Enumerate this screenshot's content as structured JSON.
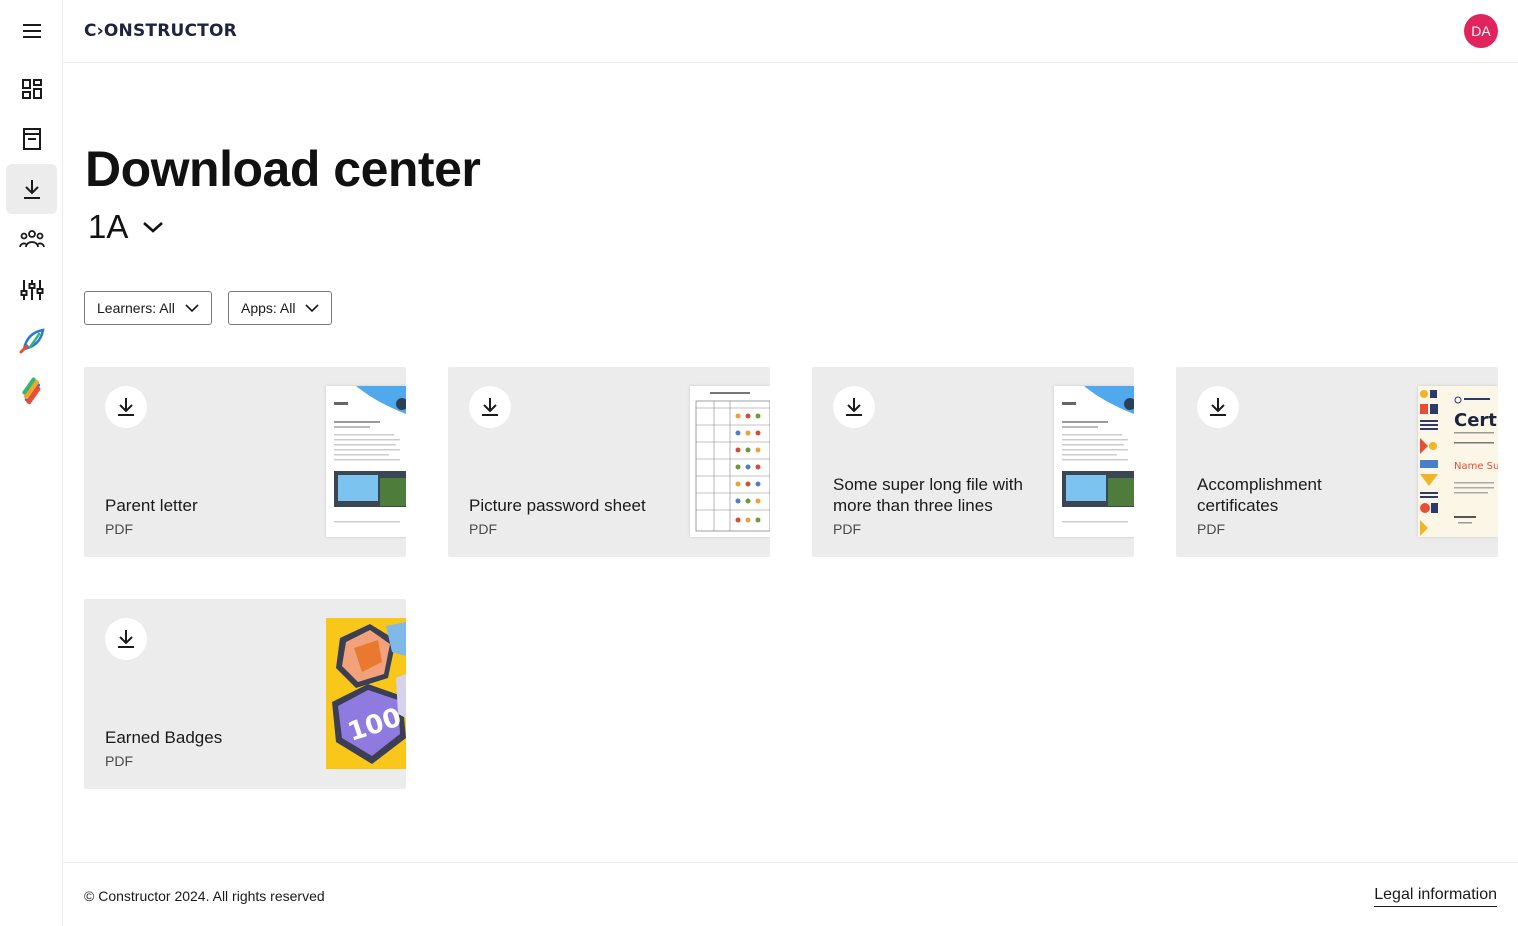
{
  "app": {
    "brand": "C›ONSTRUCTOR",
    "avatar_initials": "DA",
    "avatar_color": "#e0245e"
  },
  "sidebar": {
    "items": [
      {
        "icon": "menu-icon"
      },
      {
        "icon": "dashboard-icon"
      },
      {
        "icon": "book-icon"
      },
      {
        "icon": "download-icon",
        "active": true
      },
      {
        "icon": "people-icon"
      },
      {
        "icon": "sliders-icon"
      },
      {
        "icon": "rocket-app-icon"
      },
      {
        "icon": "colorful-app-icon"
      }
    ]
  },
  "main": {
    "title": "Download center",
    "class_selector": {
      "value": "1A"
    },
    "filters": {
      "learners": "Learners: All",
      "apps": "Apps: All"
    },
    "cards": [
      {
        "name": "Parent letter",
        "type": "PDF",
        "thumb": "letter-thumbnail"
      },
      {
        "name": "Picture password sheet",
        "type": "PDF",
        "thumb": "password-sheet-thumbnail"
      },
      {
        "name": "Some super long file with more than three lines",
        "type": "PDF",
        "thumb": "letter-thumbnail"
      },
      {
        "name": "Accomplishment certificates",
        "type": "PDF",
        "thumb": "certificate-thumbnail",
        "thumb_text": "Cert",
        "thumb_subtext": "Name Su"
      },
      {
        "name": "Earned Badges",
        "type": "PDF",
        "thumb": "badges-thumbnail",
        "thumb_text": "100"
      }
    ]
  },
  "footer": {
    "copyright": "© Constructor 2024. All rights reserved",
    "legal": "Legal information"
  }
}
